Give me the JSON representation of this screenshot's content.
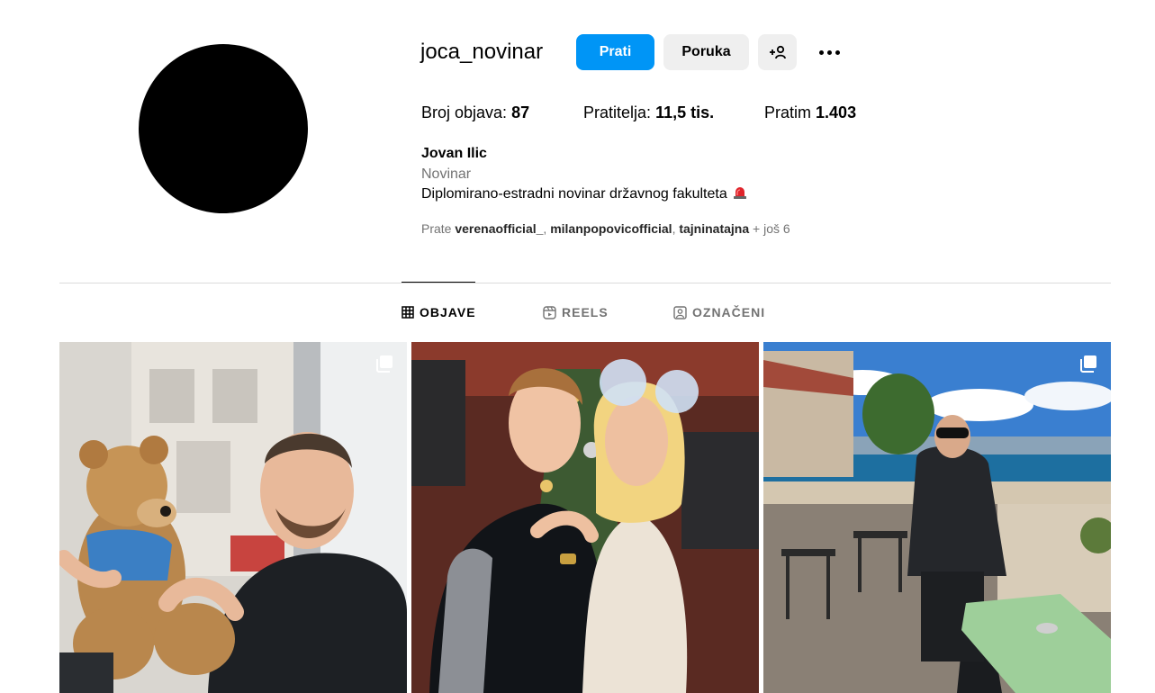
{
  "profile": {
    "username": "joca_novinar",
    "full_name": "Jovan Ilic",
    "category": "Novinar",
    "bio": "Diplomirano-estradni novinar državnog fakulteta",
    "bio_emoji": "siren-icon"
  },
  "actions": {
    "follow_label": "Prati",
    "message_label": "Poruka",
    "add_user_icon": "add-user-icon",
    "more_icon": "more-options-icon"
  },
  "stats": {
    "posts_label": "Broj objava:",
    "posts_value": "87",
    "followers_label": "Pratitelja:",
    "followers_value": "11,5 tis.",
    "following_label": "Pratim",
    "following_value": "1.403"
  },
  "followed_by": {
    "prefix": "Prate",
    "accounts": [
      "verenaofficial_",
      "milanpopovicofficial",
      "tajninatajna"
    ],
    "more": "+ još 6"
  },
  "tabs": [
    {
      "label": "OBJAVE",
      "icon": "grid-icon",
      "active": true
    },
    {
      "label": "REELS",
      "icon": "reels-icon",
      "active": false
    },
    {
      "label": "OZNAČENI",
      "icon": "tagged-icon",
      "active": false
    }
  ],
  "posts": [
    {
      "icon": "carousel-icon"
    },
    {
      "icon": ""
    },
    {
      "icon": "carousel-icon"
    }
  ],
  "colors": {
    "primary_button": "#0095f6",
    "secondary_button": "#efefef",
    "muted_text": "#737373",
    "divider": "#dbdbdb"
  }
}
